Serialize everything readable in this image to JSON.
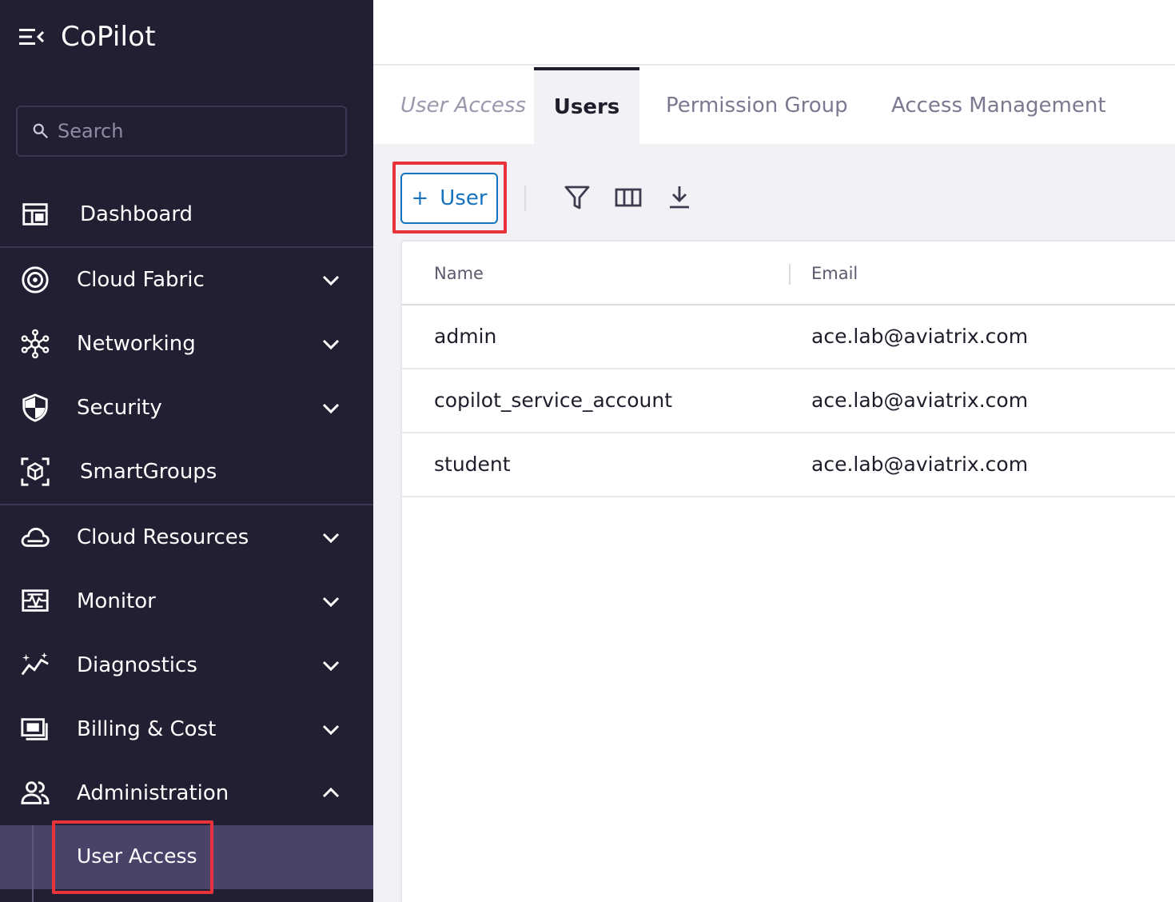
{
  "app": {
    "title": "CoPilot"
  },
  "search": {
    "placeholder": "Search"
  },
  "sidebar": {
    "items": [
      {
        "label": "Dashboard",
        "icon": "dashboard-icon"
      },
      {
        "label": "Cloud Fabric",
        "icon": "cloud-fabric-icon"
      },
      {
        "label": "Networking",
        "icon": "networking-icon"
      },
      {
        "label": "Security",
        "icon": "shield-icon"
      },
      {
        "label": "SmartGroups",
        "icon": "smartgroups-icon"
      },
      {
        "label": "Cloud Resources",
        "icon": "cloud-icon"
      },
      {
        "label": "Monitor",
        "icon": "monitor-icon"
      },
      {
        "label": "Diagnostics",
        "icon": "diagnostics-icon"
      },
      {
        "label": "Billing & Cost",
        "icon": "billing-icon"
      },
      {
        "label": "Administration",
        "icon": "users-icon"
      }
    ],
    "sub_item": {
      "label": "User Access"
    }
  },
  "tabs": {
    "crumb": "User Access",
    "items": [
      {
        "label": "Users",
        "active": true
      },
      {
        "label": "Permission Group",
        "active": false
      },
      {
        "label": "Access Management",
        "active": false
      }
    ]
  },
  "toolbar": {
    "add_label": "User",
    "add_icon": "plus-icon",
    "icons": [
      "filter-icon",
      "columns-icon",
      "download-icon"
    ]
  },
  "table": {
    "columns": [
      "Name",
      "Email"
    ],
    "rows": [
      {
        "name": "admin",
        "email": "ace.lab@aviatrix.com"
      },
      {
        "name": "copilot_service_account",
        "email": "ace.lab@aviatrix.com"
      },
      {
        "name": "student",
        "email": "ace.lab@aviatrix.com"
      }
    ]
  },
  "colors": {
    "sidebar_bg": "#211f31",
    "selected_bg": "#4b4269",
    "accent_blue": "#1473c0",
    "highlight_red": "#e8333a"
  }
}
